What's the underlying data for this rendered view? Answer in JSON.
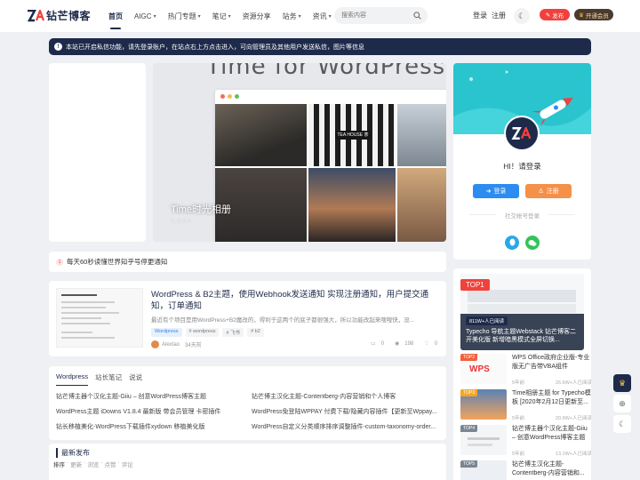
{
  "header": {
    "logo_text": "钻芒博客",
    "nav": [
      {
        "label": "首页",
        "active": true
      },
      {
        "label": "AIGC",
        "caret": true
      },
      {
        "label": "热门专题",
        "caret": true
      },
      {
        "label": "笔记",
        "caret": true
      },
      {
        "label": "资源分享"
      },
      {
        "label": "站务",
        "caret": true
      },
      {
        "label": "资讯",
        "caret": true
      }
    ],
    "search_placeholder": "搜索内容",
    "login": "登录",
    "register": "注册",
    "publish": "发布",
    "vip": "开通会员"
  },
  "notice": {
    "text": "本站已开启私信功能，请先登录账户，在站点右上方点击进入，可向管理员及其他用户发送私信，图片等信息"
  },
  "slider": {
    "big_text": "Time for WordPress",
    "caption": "Time时光相册",
    "caption_sub": "轮播图片",
    "photo_caption": "TEA HOUSE 茶"
  },
  "ticker": {
    "index": "1",
    "text": "每天60秒读懂世界知乎号停更通知"
  },
  "post": {
    "title": "WordPress & B2主题，使用Webhook发送通知 实现注册通知，用户提交通知，订单通知",
    "excerpt": "最近有个项目是用WordPress+B2魔改的，得利于这两个的底子都很强大，所以功能改起来嗖嗖快，没...",
    "tags": [
      "Wordpress",
      "# wordpress",
      "# 飞书",
      "# b2"
    ],
    "author": "Alextao",
    "time": "34天前",
    "comments": "0",
    "views": "198",
    "likes": "0"
  },
  "links": {
    "tabs": [
      "Wordpress",
      "站长笔记",
      "说说"
    ],
    "rows": [
      [
        "钻芒博主器个汉化主题-Giiu – 创意WordPress博客主题",
        "钻芒博主汉化主题-Contentberg-内容营销和个人博客"
      ],
      [
        "WordPress主题 iDowns V1.8.4 最新版 带会员管理 卡密插件",
        "WordPress免登陆WPPAY 付费下载/隐藏内容插件【更新至Wppay..."
      ],
      [
        "钻长移植美化-WordPress下载插件xydown 移植美化版",
        "WordPress自定义分类顺序排序调整插件-custom-taxonomy-order..."
      ]
    ]
  },
  "latest": {
    "title": "最新发布",
    "sorts": [
      "排序",
      "·",
      "更新",
      "·",
      "浏览",
      "·",
      "点赞",
      "·",
      "评论"
    ]
  },
  "login_card": {
    "hi": "HI！请登录",
    "login_btn": "登录",
    "register_btn": "注册",
    "social_title": "社交帐号登录"
  },
  "hot": {
    "top": {
      "badge": "TOP1",
      "views": "811W+人已阅读",
      "title": "Typecho 导航主题Webstack 钻芒博客二开美化版 新增暗黑模式全屏切换..."
    },
    "items": [
      {
        "rank": "TOP2",
        "title": "WPS Office政府企业版-专业版无广告带VBA组件",
        "time": "5年前",
        "views": "26.6W+人已阅读",
        "thumb_text": "WPS"
      },
      {
        "rank": "TOP3",
        "title": "Time相册主题 for Typecho模板 [2020年2月12日更新至...",
        "time": "5年前",
        "views": "20.9W+人已阅读"
      },
      {
        "rank": "TOP4",
        "title": "钻芒博主器个汉化主题-Giiu – 创意WordPress博客主题",
        "time": "5年前",
        "views": "13.1W+人已阅读"
      },
      {
        "rank": "TOP5",
        "title": "钻芒博主汉化主题-Contentberg-内容营销和...",
        "time": "",
        "views": ""
      }
    ]
  },
  "colors": {
    "brand_navy": "#1e2a4a",
    "publish_red": "#f2403b",
    "login_blue": "#2c8cf0",
    "register_orange": "#f59049",
    "banner_teal": "#2ac4cf"
  }
}
